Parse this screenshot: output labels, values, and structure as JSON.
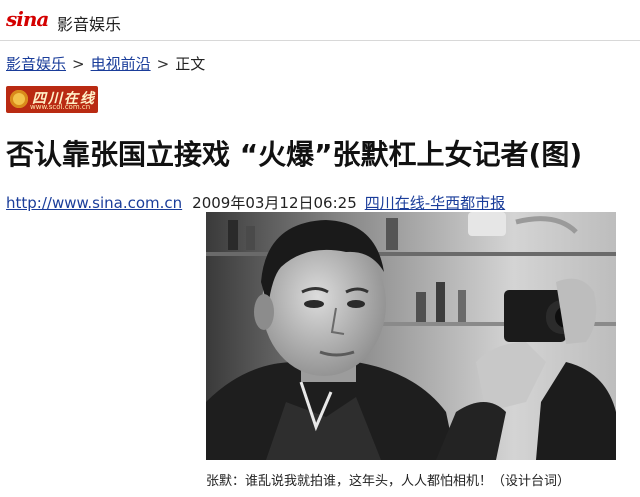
{
  "header": {
    "brand": "sina",
    "channel": "影音娱乐"
  },
  "breadcrumb": {
    "items": [
      "影音娱乐",
      "电视前沿"
    ],
    "separator": ">",
    "current": "正文"
  },
  "source_logo": {
    "name": "四川在线",
    "url_text": "www.scol.com.cn"
  },
  "article": {
    "headline": "否认靠张国立接戏 “火爆”张默杠上女记者(图)",
    "source_url": "http://www.sina.com.cn",
    "datetime": "2009年03月12日06:25",
    "source_name": "四川在线-华西都市报",
    "photo_caption": "张默：谁乱说我就拍谁，这年头，人人都怕相机！（设计台词）"
  },
  "colors": {
    "link": "#1a3d9a",
    "sina_red": "#d40000",
    "badge_red": "#b92a12"
  },
  "icons": {
    "logo": "sina-logo",
    "badge": "scol-logo"
  }
}
